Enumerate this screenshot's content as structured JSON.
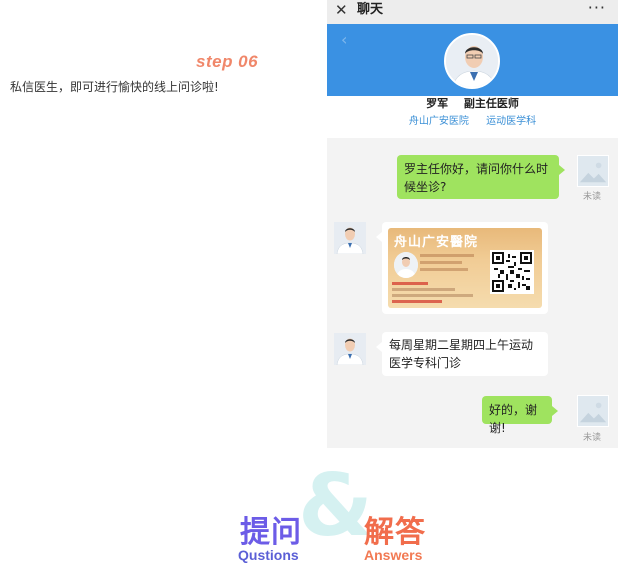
{
  "step": {
    "title": "step 06",
    "description": "私信医生，即可进行愉快的线上问诊啦!"
  },
  "chat_window": {
    "close_icon": "close-icon",
    "title": "聊天",
    "more_icon": "more-icon",
    "doctor": {
      "name": "罗军",
      "position": "副主任医师",
      "hospital": "舟山广安医院",
      "department": "运动医学科"
    },
    "messages": [
      {
        "from": "user",
        "text": "罗主任你好，请问你什么时候坐诊?",
        "status": "未读"
      },
      {
        "from": "doctor",
        "type": "card",
        "card_title": "舟山广安醫院"
      },
      {
        "from": "doctor",
        "text": "每周星期二星期四上午运动医学专科门诊"
      },
      {
        "from": "user",
        "text": "好的，谢谢!",
        "status": "未读"
      }
    ]
  },
  "qa": {
    "amp": "&",
    "ask_cn": "提问",
    "ask_en": "Qustions",
    "answer_cn": "解答",
    "answer_en": "Answers"
  },
  "colors": {
    "step_title": "#f0876a",
    "banner": "#3a91e3",
    "bubble_green": "#9fe35f",
    "ask": "#6c5ce7",
    "answer": "#f16d4c"
  }
}
